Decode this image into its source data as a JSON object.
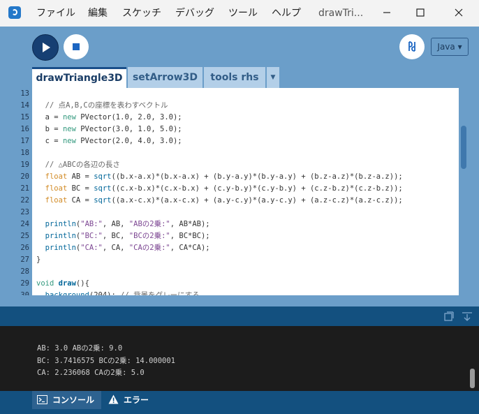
{
  "menubar": {
    "items": [
      "ファイル",
      "編集",
      "スケッチ",
      "デバッグ",
      "ツール",
      "ヘルプ"
    ],
    "window_title": "drawTri..."
  },
  "toolbar": {
    "mode": "Java ▾"
  },
  "tabs": [
    {
      "label": "drawTriangle3D"
    },
    {
      "label": "setArrow3D"
    },
    {
      "label": "tools rhs"
    }
  ],
  "editor": {
    "line_numbers": [
      "13",
      "14",
      "15",
      "16",
      "17",
      "18",
      "19",
      "20",
      "21",
      "22",
      "23",
      "24",
      "25",
      "26",
      "27",
      "28",
      "29",
      "30"
    ],
    "lines": [
      [],
      [
        {
          "t": "  // 点A,B,Cの座標を表わすベクトル",
          "c": "cm"
        }
      ],
      [
        {
          "t": "  a = ",
          "c": ""
        },
        {
          "t": "new",
          "c": "kw2"
        },
        {
          "t": " PVector(1.0, 2.0, 3.0);",
          "c": ""
        }
      ],
      [
        {
          "t": "  b = ",
          "c": ""
        },
        {
          "t": "new",
          "c": "kw2"
        },
        {
          "t": " PVector(3.0, 1.0, 5.0);",
          "c": ""
        }
      ],
      [
        {
          "t": "  c = ",
          "c": ""
        },
        {
          "t": "new",
          "c": "kw2"
        },
        {
          "t": " PVector(2.0, 4.0, 3.0);",
          "c": ""
        }
      ],
      [],
      [
        {
          "t": "  // △ABCの各辺の長さ",
          "c": "cm"
        }
      ],
      [
        {
          "t": "  ",
          "c": ""
        },
        {
          "t": "float",
          "c": "kw"
        },
        {
          "t": " AB = ",
          "c": ""
        },
        {
          "t": "sqrt",
          "c": "fn"
        },
        {
          "t": "((b.x-a.x)*(b.x-a.x) + (b.y-a.y)*(b.y-a.y) + (b.z-a.z)*(b.z-a.z));",
          "c": ""
        }
      ],
      [
        {
          "t": "  ",
          "c": ""
        },
        {
          "t": "float",
          "c": "kw"
        },
        {
          "t": " BC = ",
          "c": ""
        },
        {
          "t": "sqrt",
          "c": "fn"
        },
        {
          "t": "((c.x-b.x)*(c.x-b.x) + (c.y-b.y)*(c.y-b.y) + (c.z-b.z)*(c.z-b.z));",
          "c": ""
        }
      ],
      [
        {
          "t": "  ",
          "c": ""
        },
        {
          "t": "float",
          "c": "kw"
        },
        {
          "t": " CA = ",
          "c": ""
        },
        {
          "t": "sqrt",
          "c": "fn"
        },
        {
          "t": "((a.x-c.x)*(a.x-c.x) + (a.y-c.y)*(a.y-c.y) + (a.z-c.z)*(a.z-c.z));",
          "c": ""
        }
      ],
      [],
      [
        {
          "t": "  ",
          "c": ""
        },
        {
          "t": "println",
          "c": "fn"
        },
        {
          "t": "(",
          "c": ""
        },
        {
          "t": "\"AB:\"",
          "c": "st"
        },
        {
          "t": ", AB, ",
          "c": ""
        },
        {
          "t": "\"ABの2乗:\"",
          "c": "st"
        },
        {
          "t": ", AB*AB);",
          "c": ""
        }
      ],
      [
        {
          "t": "  ",
          "c": ""
        },
        {
          "t": "println",
          "c": "fn"
        },
        {
          "t": "(",
          "c": ""
        },
        {
          "t": "\"BC:\"",
          "c": "st"
        },
        {
          "t": ", BC, ",
          "c": ""
        },
        {
          "t": "\"BCの2乗:\"",
          "c": "st"
        },
        {
          "t": ", BC*BC);",
          "c": ""
        }
      ],
      [
        {
          "t": "  ",
          "c": ""
        },
        {
          "t": "println",
          "c": "fn"
        },
        {
          "t": "(",
          "c": ""
        },
        {
          "t": "\"CA:\"",
          "c": "st"
        },
        {
          "t": ", CA, ",
          "c": ""
        },
        {
          "t": "\"CAの2乗:\"",
          "c": "st"
        },
        {
          "t": ", CA*CA);",
          "c": ""
        }
      ],
      [
        {
          "t": "}",
          "c": ""
        }
      ],
      [],
      [
        {
          "t": "void",
          "c": "kw2"
        },
        {
          "t": " ",
          "c": ""
        },
        {
          "t": "draw",
          "c": "fnb"
        },
        {
          "t": "(){",
          "c": ""
        }
      ],
      [
        {
          "t": "  ",
          "c": ""
        },
        {
          "t": "background",
          "c": "fn"
        },
        {
          "t": "(204); ",
          "c": ""
        },
        {
          "t": "// 背景をグレーにする",
          "c": "cm"
        }
      ]
    ]
  },
  "console": {
    "lines": [
      "AB: 3.0 ABの2乗: 9.0",
      "BC: 3.7416575 BCの2乗: 14.000001",
      "CA: 2.236068 CAの2乗: 5.0"
    ]
  },
  "footer": {
    "console_label": "コンソール",
    "errors_label": "エラー"
  },
  "colors": {
    "theme_blue": "#6b9ec9",
    "dark_blue": "#13507f",
    "console_bg": "#1c1c1c"
  }
}
